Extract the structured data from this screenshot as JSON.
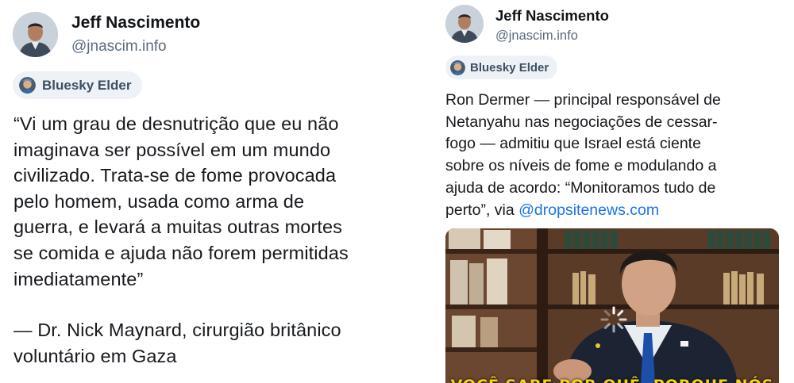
{
  "left_post": {
    "author_name": "Jeff Nascimento",
    "author_handle": "@jnascim.info",
    "badge_label": "Bluesky Elder",
    "quote_lines": [
      "“Vi um grau de desnutrição que eu não",
      "imaginava ser possível em um mundo",
      "civilizado. Trata-se de fome provocada",
      "pelo homem, usada como arma de",
      "guerra, e levará a muitas outras mortes",
      "se comida e ajuda não forem permitidas",
      "imediatamente”"
    ],
    "attribution_lines": [
      "— Dr. Nick Maynard, cirurgião britânico",
      "voluntário em Gaza"
    ]
  },
  "right_post": {
    "author_name": "Jeff Nascimento",
    "author_handle": "@jnascim.info",
    "badge_label": "Bluesky Elder",
    "text_lines": [
      "Ron Dermer — principal responsável de",
      "Netanyahu nas negociações de cessar-",
      "fogo — admitiu que Israel está ciente",
      "sobre os níveis de fome e modulando a",
      "ajuda de acordo: “Monitoramos tudo de"
    ],
    "last_line_prefix": "perto”, via ",
    "mention": "@dropsitenews.com",
    "video_caption": "VOCÊ SABE POR QUÊ, PORQUE NÓS"
  },
  "colors": {
    "mention": "#1a73e8",
    "badge_bg": "#eef2f6",
    "caption": "#f6d21b"
  }
}
